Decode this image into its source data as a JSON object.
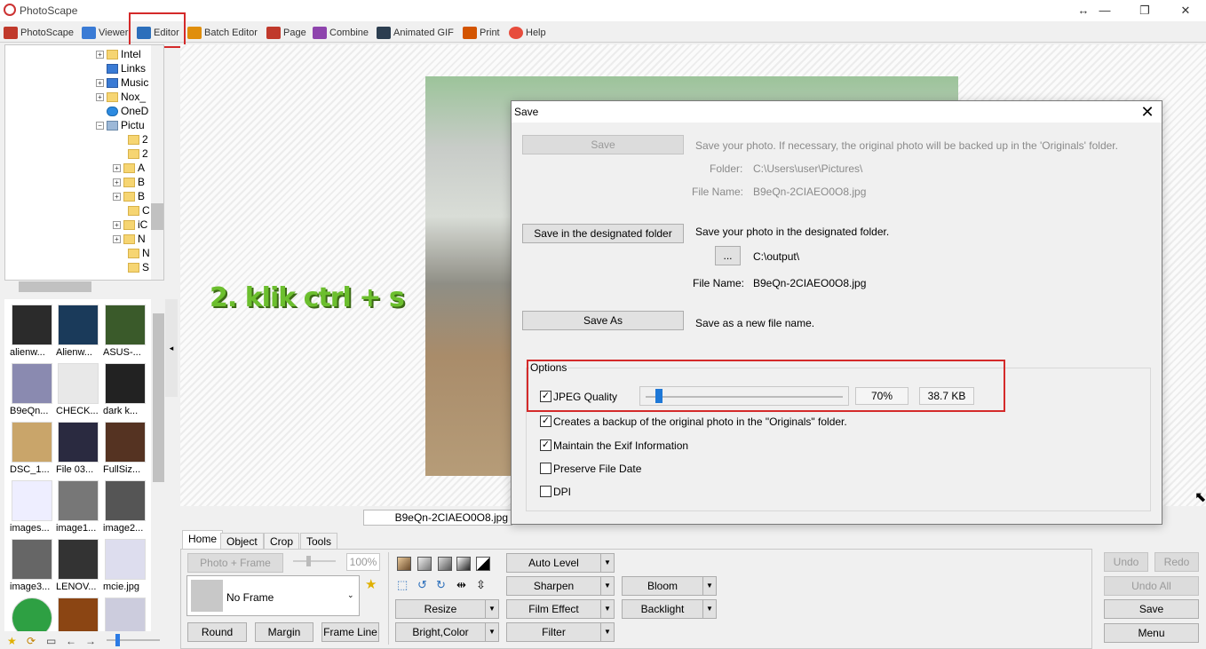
{
  "window": {
    "title": "PhotoScape",
    "controls": [
      "↔",
      "—",
      "❐",
      "✕"
    ]
  },
  "menu": [
    {
      "label": "PhotoScape",
      "icon": "photoscape-icon",
      "color": "#c0392b"
    },
    {
      "label": "Viewer",
      "icon": "viewer-icon",
      "color": "#3a7bd5"
    },
    {
      "label": "Editor",
      "icon": "editor-icon",
      "color": "#2c6fbb",
      "highlighted": true
    },
    {
      "label": "Batch Editor",
      "icon": "batch-editor-icon",
      "color": "#e08e0b"
    },
    {
      "label": "Page",
      "icon": "page-icon",
      "color": "#c0392b"
    },
    {
      "label": "Combine",
      "icon": "combine-icon",
      "color": "#8e44ad"
    },
    {
      "label": "Animated GIF",
      "icon": "animated-gif-icon",
      "color": "#2c3e50"
    },
    {
      "label": "Print",
      "icon": "print-icon",
      "color": "#d35400"
    },
    {
      "label": "Help",
      "icon": "help-icon",
      "color": "#e74c3c"
    }
  ],
  "tree": {
    "items": [
      {
        "label": "Intel",
        "expandable": true,
        "icon": "folder-icon"
      },
      {
        "label": "Links",
        "expandable": false,
        "icon": "links-icon"
      },
      {
        "label": "Music",
        "expandable": true,
        "icon": "music-icon"
      },
      {
        "label": "Nox_",
        "expandable": true,
        "icon": "folder-icon"
      },
      {
        "label": "OneD",
        "expandable": false,
        "icon": "onedrive-icon"
      },
      {
        "label": "Pictu",
        "expandable": true,
        "icon": "pictures-icon"
      },
      {
        "label": "2",
        "expandable": false,
        "icon": "folder-icon"
      },
      {
        "label": "2",
        "expandable": false,
        "icon": "folder-icon"
      },
      {
        "label": "A",
        "expandable": true,
        "icon": "folder-icon"
      },
      {
        "label": "B",
        "expandable": true,
        "icon": "folder-icon"
      },
      {
        "label": "B",
        "expandable": true,
        "icon": "folder-icon"
      },
      {
        "label": "C",
        "expandable": false,
        "icon": "folder-icon"
      },
      {
        "label": "iC",
        "expandable": true,
        "icon": "folder-icon"
      },
      {
        "label": "N",
        "expandable": true,
        "icon": "folder-icon"
      },
      {
        "label": "N",
        "expandable": false,
        "icon": "folder-icon"
      },
      {
        "label": "S",
        "expandable": false,
        "icon": "folder-icon"
      }
    ]
  },
  "thumbnails": [
    {
      "caption": "alienw...",
      "color": "#2b2b2b"
    },
    {
      "caption": "Alienw...",
      "color": "#1a3a5a"
    },
    {
      "caption": "ASUS-...",
      "color": "#3a5a2a"
    },
    {
      "caption": "B9eQn...",
      "color": "#8a8ab0"
    },
    {
      "caption": "CHECK...",
      "color": "#e8e8e8"
    },
    {
      "caption": "dark k...",
      "color": "#222"
    },
    {
      "caption": "DSC_1...",
      "color": "#c9a56a"
    },
    {
      "caption": "File 03...",
      "color": "#2a2a40"
    },
    {
      "caption": "FullSiz...",
      "color": "#553322"
    },
    {
      "caption": "images...",
      "color": "#eef"
    },
    {
      "caption": "image1...",
      "color": "#777"
    },
    {
      "caption": "image2...",
      "color": "#555"
    },
    {
      "caption": "image3...",
      "color": "#666"
    },
    {
      "caption": "LENOV...",
      "color": "#333"
    },
    {
      "caption": "mcie.jpg",
      "color": "#dde"
    },
    {
      "caption": "",
      "color": "#2ea043"
    },
    {
      "caption": "",
      "color": "#8b4513"
    },
    {
      "caption": "",
      "color": "#ccd"
    }
  ],
  "canvas": {
    "overlay_text": "2. klik ctrl + s",
    "filename": "B9eQn-2CIAEO0O8.jpg"
  },
  "bottom_tabs": [
    "Home",
    "Object",
    "Crop",
    "Tools"
  ],
  "home_panel": {
    "photo_frame": "Photo + Frame",
    "zoom": "100%",
    "frame_select": "No Frame",
    "round": "Round",
    "margin": "Margin",
    "frame_line": "Frame Line",
    "resize": "Resize",
    "bright_color": "Bright,Color",
    "auto_level": "Auto Level",
    "sharpen": "Sharpen",
    "film_effect": "Film Effect",
    "filter": "Filter",
    "bloom": "Bloom",
    "backlight": "Backlight"
  },
  "side_buttons": {
    "undo": "Undo",
    "redo": "Redo",
    "undo_all": "Undo All",
    "save": "Save",
    "menu": "Menu"
  },
  "dialog": {
    "title": "Save",
    "save": {
      "button": "Save",
      "desc": "Save your photo. If necessary, the original photo will be backed up in the 'Originals' folder.",
      "folder_label": "Folder:",
      "folder_value": "C:\\Users\\user\\Pictures\\",
      "filename_label": "File Name:",
      "filename_value": "B9eQn-2CIAEO0O8.jpg"
    },
    "designated": {
      "button": "Save in the designated folder",
      "desc": "Save your photo in the designated folder.",
      "browse": "...",
      "folder_value": "C:\\output\\",
      "filename_label": "File Name:",
      "filename_value": "B9eQn-2CIAEO0O8.jpg"
    },
    "save_as": {
      "button": "Save As",
      "desc": "Save as a new file name."
    },
    "options": {
      "title": "Options",
      "jpeg_quality": {
        "label": "JPEG Quality",
        "checked": true,
        "percent": "70%",
        "value_fraction": 0.05,
        "size": "38.7 KB"
      },
      "backup": {
        "label": "Creates a backup of the original photo in the \"Originals\" folder.",
        "checked": true
      },
      "exif": {
        "label": "Maintain the Exif Information",
        "checked": true
      },
      "file_date": {
        "label": "Preserve File Date",
        "checked": false
      },
      "dpi": {
        "label": "DPI",
        "checked": false
      }
    }
  },
  "accent": "#d42a2a"
}
